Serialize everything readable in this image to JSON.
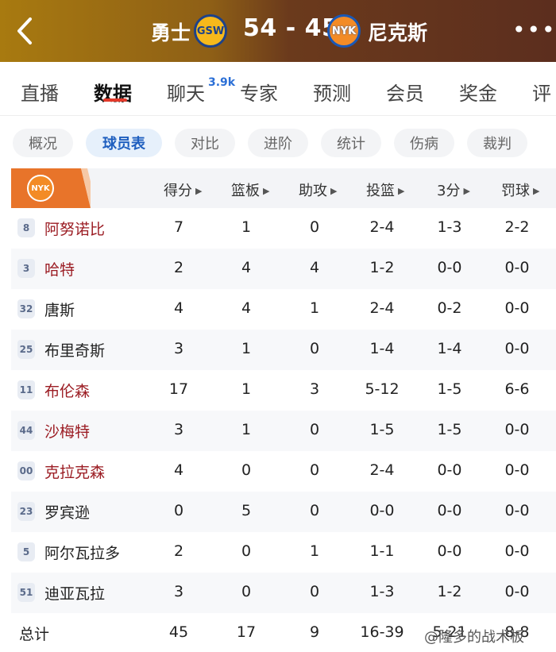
{
  "header": {
    "home_team": "勇士",
    "home_logo": "GSW",
    "score": "54 - 45",
    "away_logo": "NYK",
    "away_team": "尼克斯",
    "more": "•••"
  },
  "main_tabs": [
    {
      "label": "直播"
    },
    {
      "label": "数据"
    },
    {
      "label": "聊天"
    },
    {
      "label": "专家"
    },
    {
      "label": "预测"
    },
    {
      "label": "会员"
    },
    {
      "label": "奖金"
    },
    {
      "label": "评"
    }
  ],
  "chat_badge": "3.9k",
  "sub_tabs": [
    {
      "label": "概况"
    },
    {
      "label": "球员表"
    },
    {
      "label": "对比"
    },
    {
      "label": "进阶"
    },
    {
      "label": "统计"
    },
    {
      "label": "伤病"
    },
    {
      "label": "裁判"
    }
  ],
  "table": {
    "team_logo": "NYK",
    "columns": [
      "得分",
      "篮板",
      "助攻",
      "投篮",
      "3分",
      "罚球"
    ],
    "rows": [
      {
        "number": "8",
        "name": "阿努诺比",
        "pts": "7",
        "reb": "1",
        "ast": "0",
        "fg": "2-4",
        "tp": "1-3",
        "ft": "2-2"
      },
      {
        "number": "3",
        "name": "哈特",
        "pts": "2",
        "reb": "4",
        "ast": "4",
        "fg": "1-2",
        "tp": "0-0",
        "ft": "0-0"
      },
      {
        "number": "32",
        "name": "唐斯",
        "pts": "4",
        "reb": "4",
        "ast": "1",
        "fg": "2-4",
        "tp": "0-2",
        "ft": "0-0"
      },
      {
        "number": "25",
        "name": "布里奇斯",
        "pts": "3",
        "reb": "1",
        "ast": "0",
        "fg": "1-4",
        "tp": "1-4",
        "ft": "0-0"
      },
      {
        "number": "11",
        "name": "布伦森",
        "pts": "17",
        "reb": "1",
        "ast": "3",
        "fg": "5-12",
        "tp": "1-5",
        "ft": "6-6"
      },
      {
        "number": "44",
        "name": "沙梅特",
        "pts": "3",
        "reb": "1",
        "ast": "0",
        "fg": "1-5",
        "tp": "1-5",
        "ft": "0-0"
      },
      {
        "number": "00",
        "name": "克拉克森",
        "pts": "4",
        "reb": "0",
        "ast": "0",
        "fg": "2-4",
        "tp": "0-0",
        "ft": "0-0"
      },
      {
        "number": "23",
        "name": "罗宾逊",
        "pts": "0",
        "reb": "5",
        "ast": "0",
        "fg": "0-0",
        "tp": "0-0",
        "ft": "0-0"
      },
      {
        "number": "5",
        "name": "阿尔瓦拉多",
        "pts": "2",
        "reb": "0",
        "ast": "1",
        "fg": "1-1",
        "tp": "0-0",
        "ft": "0-0"
      },
      {
        "number": "51",
        "name": "迪亚瓦拉",
        "pts": "3",
        "reb": "0",
        "ast": "0",
        "fg": "1-3",
        "tp": "1-2",
        "ft": "0-0"
      }
    ],
    "total": {
      "label": "总计",
      "pts": "45",
      "reb": "17",
      "ast": "9",
      "fg": "16-39",
      "tp": "5-21",
      "ft": "8-8"
    }
  },
  "watermark": "@隆多的战术板",
  "colors": {
    "starter_name": "#9b1c23",
    "active_tab_underline": "#e33a2b",
    "active_subtab": "#1f5fbf"
  }
}
